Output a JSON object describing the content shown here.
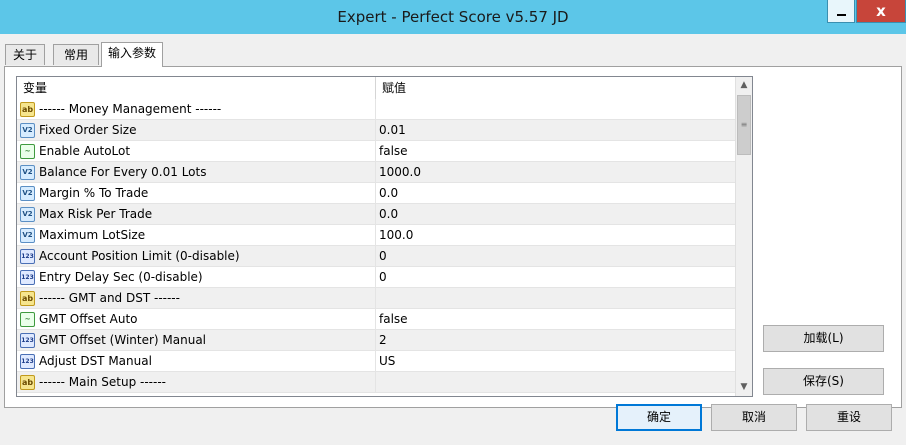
{
  "window": {
    "title": "Expert - Perfect Score v5.57 JD",
    "minimize": "",
    "close": "x"
  },
  "tabs": [
    {
      "label": "关于"
    },
    {
      "label": "常用"
    },
    {
      "label": "输入参数"
    }
  ],
  "grid": {
    "headers": {
      "name": "变量",
      "value": "赋值"
    },
    "rows": [
      {
        "icon": "ab",
        "name": "------ Money Management ------",
        "value": ""
      },
      {
        "icon": "v2",
        "name": "Fixed Order Size",
        "value": "0.01"
      },
      {
        "icon": "b",
        "name": "Enable AutoLot",
        "value": "false"
      },
      {
        "icon": "v2",
        "name": "Balance For Every 0.01 Lots",
        "value": "1000.0"
      },
      {
        "icon": "v2",
        "name": "Margin % To Trade",
        "value": "0.0"
      },
      {
        "icon": "v2",
        "name": "Max Risk Per Trade",
        "value": "0.0"
      },
      {
        "icon": "v2",
        "name": "Maximum LotSize",
        "value": "100.0"
      },
      {
        "icon": "123",
        "name": "Account Position Limit (0-disable)",
        "value": "0"
      },
      {
        "icon": "123",
        "name": "Entry Delay Sec (0-disable)",
        "value": "0"
      },
      {
        "icon": "ab",
        "name": "------ GMT and DST ------",
        "value": ""
      },
      {
        "icon": "b",
        "name": "GMT Offset Auto",
        "value": "false"
      },
      {
        "icon": "123",
        "name": "GMT Offset (Winter) Manual",
        "value": "2"
      },
      {
        "icon": "123",
        "name": "Adjust DST Manual",
        "value": "US"
      },
      {
        "icon": "ab",
        "name": "------ Main Setup ------",
        "value": ""
      }
    ]
  },
  "icon_glyphs": {
    "ab": "ab",
    "v2": "V2",
    "b": "~",
    "123": "123"
  },
  "buttons": {
    "load": "加载(L)",
    "save": "保存(S)",
    "ok": "确定",
    "cancel": "取消",
    "reset": "重设"
  },
  "colors": {
    "titlebar": "#5cc6e8",
    "close_button": "#c7453a",
    "focus_border": "#0078d7"
  }
}
